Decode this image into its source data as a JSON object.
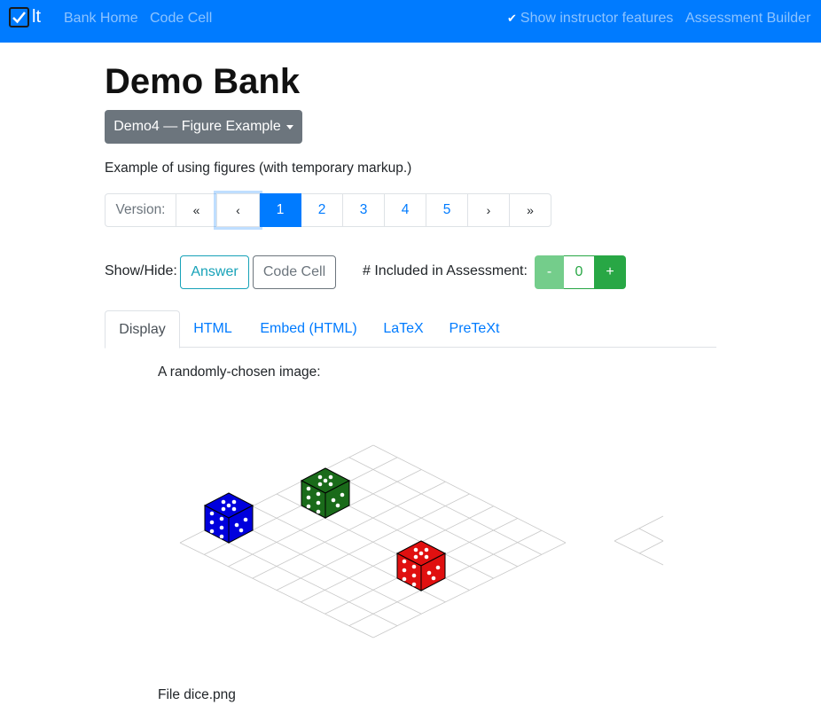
{
  "navbar": {
    "brand_text": "lt",
    "links": {
      "bank_home": "Bank Home",
      "code_cell": "Code Cell",
      "show_instructor": "Show instructor features",
      "assessment_builder": "Assessment Builder"
    },
    "bg_color": "#007bff"
  },
  "header": {
    "title": "Demo Bank",
    "dropdown_label": "Demo4 — Figure Example",
    "description": "Example of using figures (with temporary markup.)"
  },
  "pagination": {
    "label": "Version:",
    "first": "«",
    "prev": "‹",
    "pages": [
      "1",
      "2",
      "3",
      "4",
      "5"
    ],
    "active_page": "1",
    "next": "›",
    "last": "»"
  },
  "controls": {
    "show_hide_label": "Show/Hide:",
    "answer_button": "Answer",
    "code_cell_button": "Code Cell",
    "included_label": "# Included in Assessment:",
    "minus": "-",
    "count": "0",
    "plus": "+"
  },
  "tabs": [
    {
      "label": "Display",
      "active": true
    },
    {
      "label": "HTML",
      "active": false
    },
    {
      "label": "Embed (HTML)",
      "active": false
    },
    {
      "label": "LaTeX",
      "active": false
    },
    {
      "label": "PreTeXt",
      "active": false
    }
  ],
  "content": {
    "intro": "A randomly-chosen image:",
    "caption": "File dice.png",
    "dice_colors": {
      "blue": "#0000dd",
      "green": "#1a6b1a",
      "red": "#e01010"
    }
  }
}
